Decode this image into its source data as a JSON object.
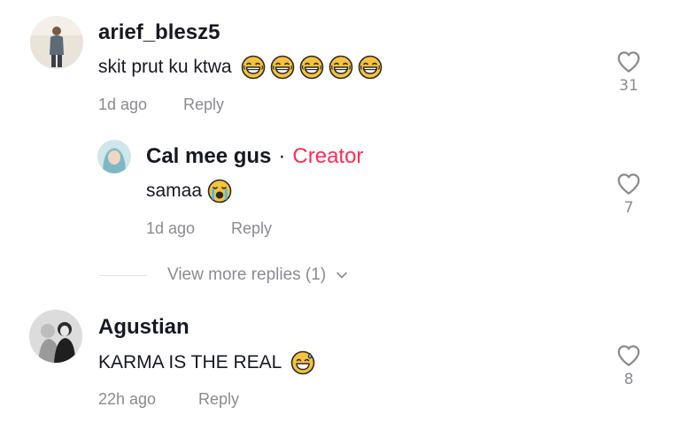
{
  "comments": [
    {
      "username": "arief_blesz5",
      "text": "skit prut ku ktwa",
      "emoji": [
        "laughing-tears-emoji",
        "laughing-tears-emoji",
        "laughing-tears-emoji",
        "laughing-tears-emoji",
        "laughing-tears-emoji"
      ],
      "time": "1d ago",
      "reply_label": "Reply",
      "likes": "31",
      "replies": [
        {
          "username": "Cal mee gus",
          "separator": "·",
          "badge": "Creator",
          "text": "samaa",
          "emoji": [
            "loudly-crying-emoji"
          ],
          "time": "1d ago",
          "reply_label": "Reply",
          "likes": "7"
        }
      ],
      "view_more": "View more replies (1)"
    },
    {
      "username": "Agustian",
      "text": "KARMA IS THE REAL",
      "emoji": [
        "grinning-sweat-emoji"
      ],
      "time": "22h ago",
      "reply_label": "Reply",
      "likes": "8"
    }
  ],
  "colors": {
    "creator": "#fe2c55",
    "muted": "#8a8b91",
    "text": "#161823",
    "emoji_yellow": "#f7c23c"
  }
}
